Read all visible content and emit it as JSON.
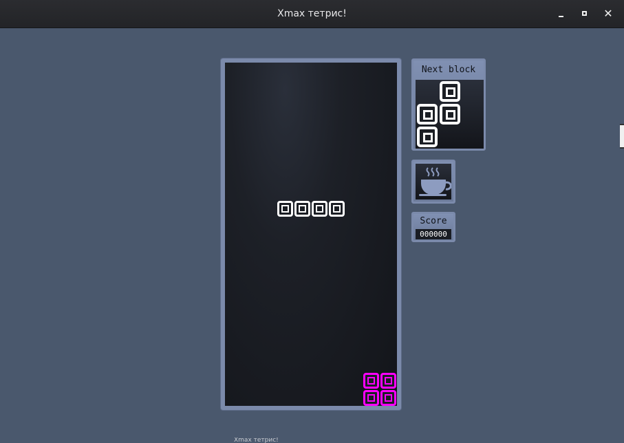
{
  "window": {
    "title": "Xmax тетрис!",
    "minimize_icon": "minimize-icon",
    "maximize_icon": "maximize-icon",
    "close_icon": "close-icon",
    "close_glyph": "✕"
  },
  "game": {
    "field": {
      "falling_piece": {
        "color": "#ffffff",
        "shape": "I",
        "cells": [
          [
            3,
            8
          ],
          [
            4,
            8
          ],
          [
            5,
            8
          ],
          [
            6,
            8
          ]
        ]
      },
      "settled_cells": [
        {
          "col": 8,
          "row": 18,
          "color": "#ff00ff"
        },
        {
          "col": 9,
          "row": 18,
          "color": "#ff00ff"
        },
        {
          "col": 8,
          "row": 19,
          "color": "#ff00ff"
        },
        {
          "col": 9,
          "row": 19,
          "color": "#ff00ff"
        }
      ]
    },
    "next_block": {
      "label": "Next block",
      "cells": [
        [
          1,
          0
        ],
        [
          0,
          1
        ],
        [
          1,
          1
        ],
        [
          0,
          2
        ]
      ],
      "color": "#ffffff"
    },
    "pause": {
      "icon": "coffee-cup-icon"
    },
    "score": {
      "label": "Score",
      "value": "000000"
    }
  },
  "taskbar": {
    "hint": "Xmax тетрис!"
  }
}
